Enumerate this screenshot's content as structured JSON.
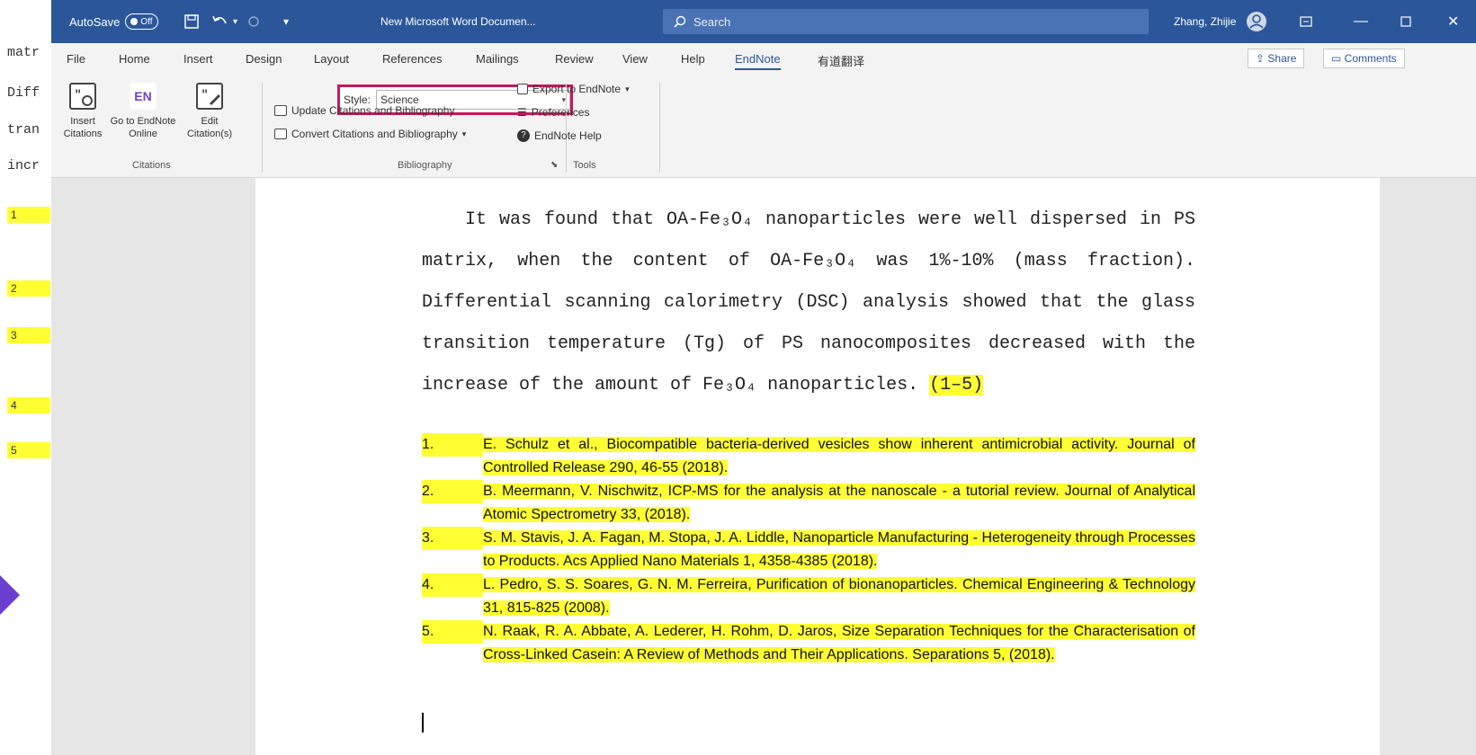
{
  "background_doc": {
    "lines": [
      "matr",
      "Diff",
      "tran",
      "incr"
    ],
    "numbers": [
      "1",
      "2",
      "3",
      "4",
      "5"
    ]
  },
  "titlebar": {
    "autosave_label": "AutoSave",
    "autosave_state": "Off",
    "document_title": "New Microsoft Word Documen...",
    "search_placeholder": "Search",
    "user_name": "Zhang, Zhijie"
  },
  "tabs": [
    "File",
    "Home",
    "Insert",
    "Design",
    "Layout",
    "References",
    "Mailings",
    "Review",
    "View",
    "Help",
    "EndNote",
    "有道翻译"
  ],
  "share_label": "Share",
  "comments_label": "Comments",
  "ribbon": {
    "citations": {
      "insert_label": "Insert Citations",
      "goto_label": "Go to EndNote Online",
      "edit_label": "Edit Citation(s)",
      "group_label": "Citations",
      "en_icon_text": "EN"
    },
    "bibliography": {
      "style_label": "Style:",
      "style_value": "Science",
      "update_label": "Update Citations and Bibliography",
      "convert_label": "Convert Citations and Bibliography",
      "group_label": "Bibliography"
    },
    "tools": {
      "export_label": "Export to EndNote",
      "preferences_label": "Preferences",
      "help_label": "EndNote Help",
      "group_label": "Tools"
    }
  },
  "document": {
    "paragraph": "It was found that OA-Fe₃O₄ nanoparticles were well dispersed in PS matrix, when the content of OA-Fe₃O₄ was 1%-10% (mass fraction). Differential scanning calorimetry (DSC) analysis showed that the glass transition temperature (Tg) of PS nanocomposites decreased with the increase of the amount of Fe₃O₄ nanoparticles.",
    "citation": "(1–5)",
    "references": [
      {
        "num": "1.",
        "text": "E. Schulz et al., Biocompatible bacteria-derived vesicles show inherent antimicrobial activity. Journal of Controlled Release 290, 46-55 (2018)."
      },
      {
        "num": "2.",
        "text": "B. Meermann, V. Nischwitz, ICP-MS for the analysis at the nanoscale - a tutorial review. Journal of Analytical Atomic Spectrometry 33, (2018)."
      },
      {
        "num": "3.",
        "text": "S. M. Stavis, J. A. Fagan, M. Stopa, J. A. Liddle, Nanoparticle Manufacturing - Heterogeneity through Processes to Products. Acs Applied Nano Materials 1, 4358-4385 (2018)."
      },
      {
        "num": "4.",
        "text": "L. Pedro, S. S. Soares, G. N. M. Ferreira, Purification of bionanoparticles. Chemical Engineering & Technology 31, 815-825 (2008)."
      },
      {
        "num": "5.",
        "text": "N. Raak, R. A. Abbate, A. Lederer, H. Rohm, D. Jaros, Size Separation Techniques for the Characterisation of Cross-Linked Casein: A Review of Methods and Their Applications. Separations 5, (2018)."
      }
    ]
  },
  "colors": {
    "titlebar": "#2b579a",
    "highlight": "#ffff33",
    "style_box_border": "#c8185f"
  }
}
